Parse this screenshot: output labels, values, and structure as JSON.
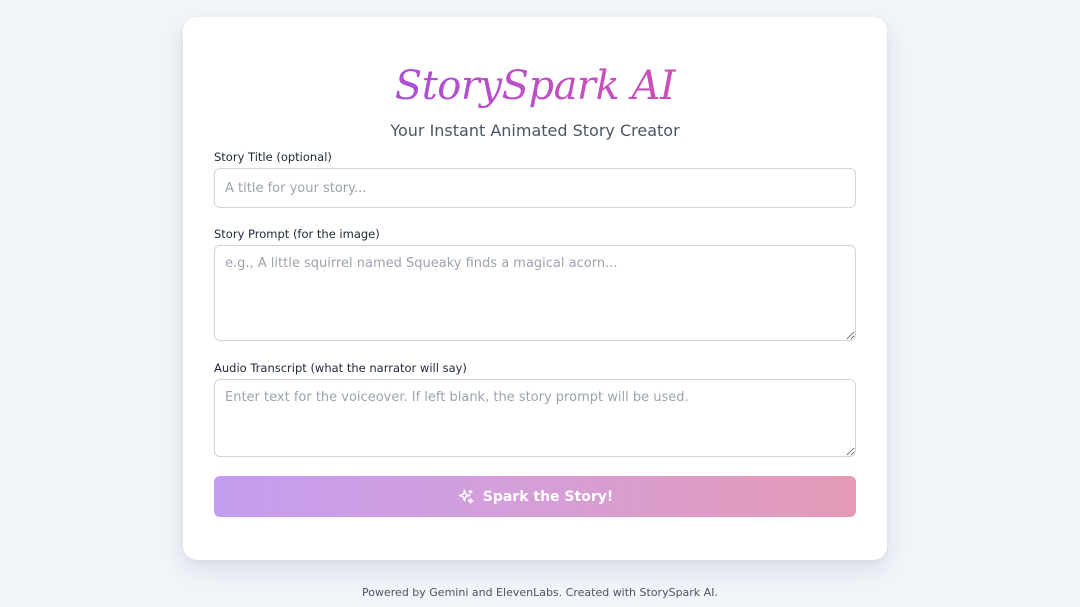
{
  "app": {
    "brand": "StorySpark AI",
    "tagline": "Your Instant Animated Story Creator"
  },
  "form": {
    "title": {
      "label": "Story Title (optional)",
      "value": "",
      "placeholder": "A title for your story..."
    },
    "prompt": {
      "label": "Story Prompt (for the image)",
      "value": "",
      "placeholder": "e.g., A little squirrel named Squeaky finds a magical acorn..."
    },
    "transcript": {
      "label": "Audio Transcript (what the narrator will say)",
      "value": "",
      "placeholder": "Enter text for the voiceover. If left blank, the story prompt will be used."
    },
    "submit": {
      "label": "Spark the Story!",
      "icon": "sparkles-icon"
    }
  },
  "footer": {
    "text": "Powered by Gemini and ElevenLabs. Created with StorySpark AI."
  },
  "colors": {
    "background": "#f1f4f9",
    "brand_gradient": [
      "#8b52e8",
      "#c24fc2",
      "#e0509a"
    ],
    "button_gradient": [
      "#c49df0",
      "#d59ed7",
      "#e49ab5"
    ]
  }
}
